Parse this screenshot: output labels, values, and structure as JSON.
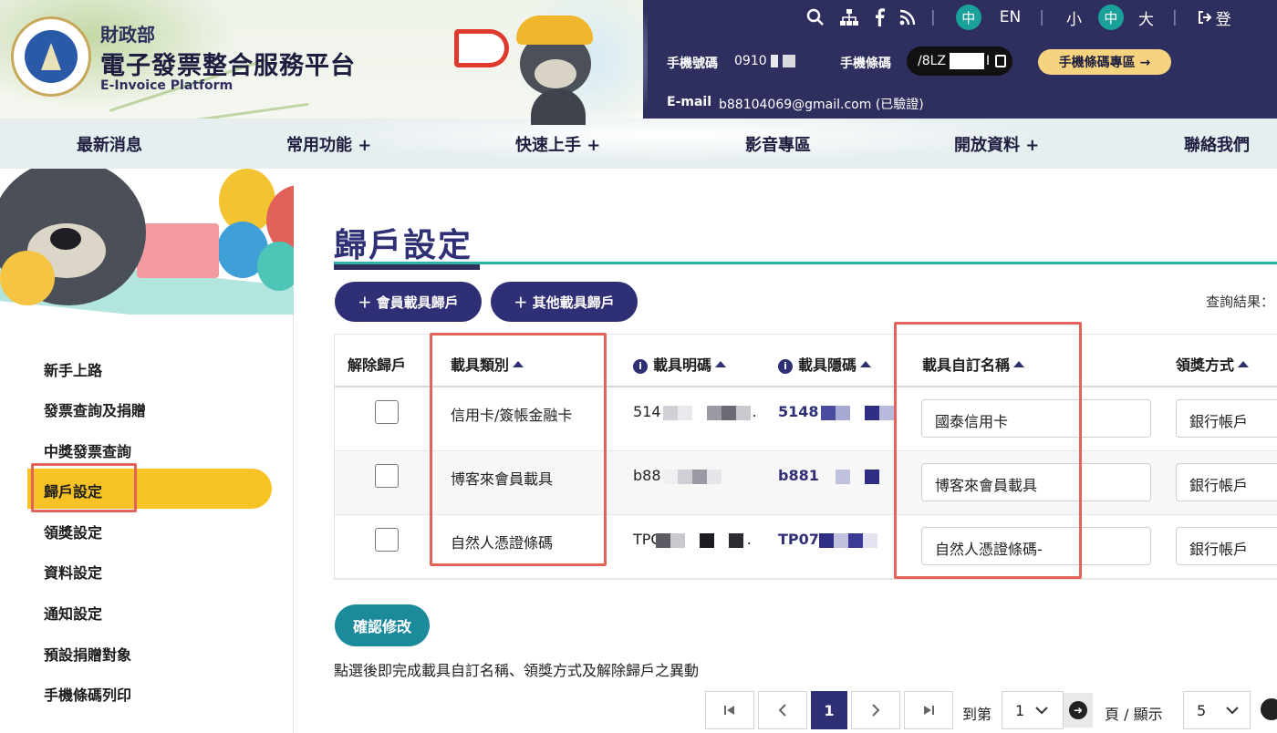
{
  "header": {
    "ministry": "財政部",
    "site_name": "電子發票整合服務平台",
    "site_name_en": "E-Invoice Platform",
    "lang": {
      "zh": "中",
      "en": "EN"
    },
    "font_size": {
      "small": "小",
      "medium": "中",
      "large": "大"
    },
    "login_partial": "登",
    "phone_label": "手機號碼",
    "phone_value": "0910",
    "barcode_label": "手機條碼",
    "barcode_value": "/8LZ",
    "barcode_tail": "I",
    "mobile_zone_button": "手機條碼專區 →",
    "email_label": "E-mail",
    "email_value": "b88104069@gmail.com (已驗證)"
  },
  "nav": {
    "items": [
      {
        "label": "最新消息"
      },
      {
        "label": "常用功能 +"
      },
      {
        "label": "快速上手 +"
      },
      {
        "label": "影音專區"
      },
      {
        "label": "開放資料 +"
      },
      {
        "label": "聯絡我們"
      }
    ]
  },
  "sidebar": {
    "items": [
      {
        "label": "新手上路"
      },
      {
        "label": "發票查詢及捐贈"
      },
      {
        "label": "中獎發票查詢"
      },
      {
        "label": "歸戶設定",
        "active": true
      },
      {
        "label": "領獎設定"
      },
      {
        "label": "資料設定"
      },
      {
        "label": "通知設定"
      },
      {
        "label": "預設捐贈對象"
      },
      {
        "label": "手機條碼列印"
      }
    ]
  },
  "main": {
    "title": "歸戶設定",
    "buttons": {
      "member_carrier": "＋ 會員載具歸戶",
      "other_carrier": "＋ 其他載具歸戶"
    },
    "query_result": "查詢結果：",
    "table": {
      "headers": {
        "unlink": "解除歸戶",
        "carrier_type": "載具類別",
        "carrier_visible": "載具明碼",
        "carrier_hidden": "載具隱碼",
        "custom_name": "載具自訂名稱",
        "award_method": "領獎方式"
      },
      "rows": [
        {
          "carrier_type": "信用卡/簽帳金融卡",
          "visible_code": "514",
          "visible_tail": ".",
          "hidden_code": "5148",
          "custom_name": "國泰信用卡",
          "award_method": "銀行帳戶"
        },
        {
          "carrier_type": "博客來會員載具",
          "visible_code": "b88",
          "visible_tail": "",
          "hidden_code": "b881",
          "custom_name": "博客來會員載具",
          "award_method": "銀行帳戶"
        },
        {
          "carrier_type": "自然人憑證條碼",
          "visible_code": "TPC",
          "visible_tail": ".",
          "hidden_code": "TP07",
          "custom_name": "自然人憑證條碼-",
          "award_method": "銀行帳戶"
        }
      ]
    },
    "confirm_button": "確認修改",
    "hint": "點選後即完成載具自訂名稱、領獎方式及解除歸戶之異動"
  },
  "pagination": {
    "current_page": "1",
    "goto_label": "到第",
    "goto_value": "1",
    "page_label": "頁 / 顯示",
    "page_size": "5"
  },
  "colors": {
    "navy": "#2e2f74",
    "teal": "#1b8b9c",
    "highlight_yellow": "#f7c324",
    "annotation_red": "#e26459"
  }
}
